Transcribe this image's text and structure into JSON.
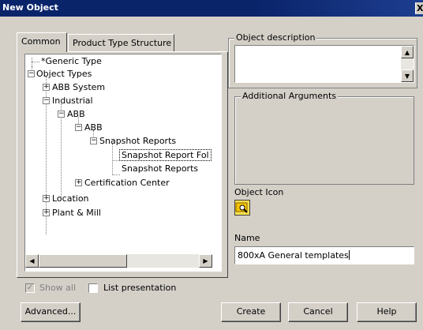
{
  "window": {
    "title": "New Object",
    "close_glyph": "X"
  },
  "tabs": [
    {
      "label": "Common"
    },
    {
      "label": "Product Type Structure"
    }
  ],
  "tree": {
    "nodes": [
      {
        "label": "*Generic Type"
      },
      {
        "label": "Object Types",
        "expander": "−"
      },
      {
        "label": "ABB System",
        "expander": "+"
      },
      {
        "label": "Industrial",
        "expander": "−"
      },
      {
        "label": "ABB",
        "expander": "−"
      },
      {
        "label": "ABB",
        "expander": "−"
      },
      {
        "label": "Snapshot Reports",
        "expander": "−"
      },
      {
        "label": "Snapshot Report Fol",
        "selected": true
      },
      {
        "label": "Snapshot Reports"
      },
      {
        "label": "Certification Center",
        "expander": "+"
      },
      {
        "label": "Location",
        "expander": "+"
      },
      {
        "label": "Plant & Mill",
        "expander": "+"
      }
    ]
  },
  "object_description": {
    "label": "Object description",
    "value": ""
  },
  "additional_arguments": {
    "label": "Additional Arguments"
  },
  "object_icon": {
    "label": "Object Icon",
    "icon": "folder-search-icon"
  },
  "name_field": {
    "label": "Name",
    "value": "800xA General templates"
  },
  "options": {
    "show_all": {
      "label": "Show all",
      "checked": true,
      "enabled": false
    },
    "list_presentation": {
      "label": "List presentation",
      "checked": false
    }
  },
  "buttons": {
    "advanced": "Advanced...",
    "create": "Create",
    "cancel": "Cancel",
    "help": "Help"
  },
  "glyphs": {
    "up": "▲",
    "down": "▼",
    "left": "◀",
    "right": "▶",
    "check": "✓"
  }
}
